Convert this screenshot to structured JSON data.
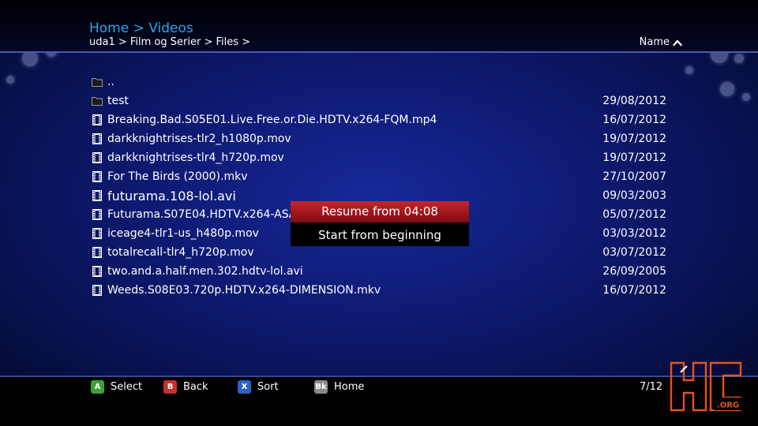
{
  "header": {
    "title": "Home > Videos",
    "path": "uda1 > Film og Serier > Files >",
    "sort_label": "Name"
  },
  "files": [
    {
      "type": "folder",
      "name": "..",
      "date": ""
    },
    {
      "type": "folder",
      "name": "test",
      "date": "29/08/2012"
    },
    {
      "type": "video",
      "name": "Breaking.Bad.S05E01.Live.Free.or.Die.HDTV.x264-FQM.mp4",
      "date": "16/07/2012"
    },
    {
      "type": "video",
      "name": "darkknightrises-tlr2_h1080p.mov",
      "date": "19/07/2012"
    },
    {
      "type": "video",
      "name": "darkknightrises-tlr4_h720p.mov",
      "date": "19/07/2012"
    },
    {
      "type": "video",
      "name": "For The Birds (2000).mkv",
      "date": "27/10/2007"
    },
    {
      "type": "video",
      "name": "futurama.108-lol.avi",
      "date": "09/03/2003",
      "selected": true
    },
    {
      "type": "video",
      "name": "Futurama.S07E04.HDTV.x264-ASAP",
      "date": "05/07/2012"
    },
    {
      "type": "video",
      "name": "iceage4-tlr1-us_h480p.mov",
      "date": "03/03/2012"
    },
    {
      "type": "video",
      "name": "totalrecall-tlr4_h720p.mov",
      "date": "03/07/2012"
    },
    {
      "type": "video",
      "name": "two.and.a.half.men.302.hdtv-lol.avi",
      "date": "26/09/2005"
    },
    {
      "type": "video",
      "name": "Weeds.S08E03.720p.HDTV.x264-DIMENSION.mkv",
      "date": "16/07/2012"
    }
  ],
  "context_menu": {
    "resume": "Resume from 04:08",
    "restart": "Start from beginning"
  },
  "footer": {
    "hints": [
      {
        "key": "A",
        "label": "Select",
        "color": "#3aa336"
      },
      {
        "key": "B",
        "label": "Back",
        "color": "#c8302f"
      },
      {
        "key": "X",
        "label": "Sort",
        "color": "#2a62c4"
      },
      {
        "key": "Bk",
        "label": "Home",
        "color": "#8a8a8a"
      }
    ],
    "page_counter": "7/12"
  },
  "colors": {
    "title": "#2aa6ea",
    "selection": "#b01d24",
    "watermark": "#e8541a"
  },
  "watermark": {
    "text": "HC.ORG"
  }
}
